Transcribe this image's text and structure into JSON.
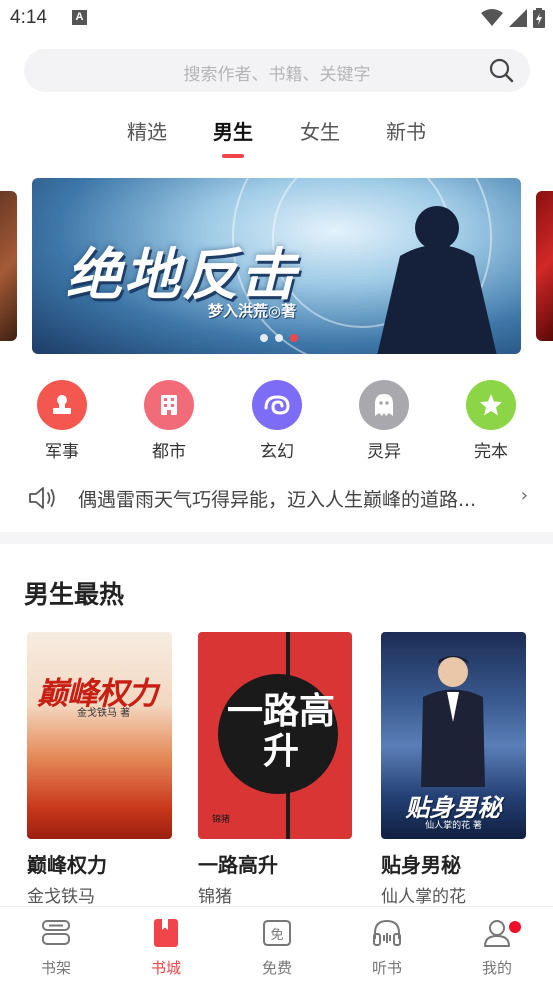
{
  "status_bar": {
    "time": "4:14",
    "notification_icon": "A"
  },
  "search": {
    "placeholder": "搜索作者、书籍、关键字"
  },
  "tabs": [
    {
      "label": "精选",
      "active": false
    },
    {
      "label": "男生",
      "active": true
    },
    {
      "label": "女生",
      "active": false
    },
    {
      "label": "新书",
      "active": false
    }
  ],
  "banner": {
    "title": "绝地反击",
    "author": "梦入洪荒◎著",
    "dots": 3,
    "active_dot": 3
  },
  "categories": [
    {
      "label": "军事",
      "icon": "stamp-icon",
      "color": "#f4574f"
    },
    {
      "label": "都市",
      "icon": "building-icon",
      "color": "#f26b78"
    },
    {
      "label": "玄幻",
      "icon": "swirl-icon",
      "color": "#7d6cf6"
    },
    {
      "label": "灵异",
      "icon": "ghost-icon",
      "color": "#a9a9ad"
    },
    {
      "label": "完本",
      "icon": "star-icon",
      "color": "#8bd546"
    }
  ],
  "notice": {
    "text": "偶遇雷雨天气巧得异能，迈入人生巅峰的道路..."
  },
  "section": {
    "title": "男生最热"
  },
  "books": [
    {
      "title": "巅峰权力",
      "author": "金戈铁马",
      "cover_text": "巅峰权力",
      "cover_author": "金戈铁马 著"
    },
    {
      "title": "一路高升",
      "author": "锦猪",
      "cover_text": "一路高升",
      "cover_author": "锦猪"
    },
    {
      "title": "贴身男秘",
      "author": "仙人掌的花",
      "cover_text": "贴身男秘",
      "cover_author": "仙人掌的花 著"
    }
  ],
  "bottom_nav": [
    {
      "label": "书架",
      "icon": "bookshelf-icon",
      "active": false
    },
    {
      "label": "书城",
      "icon": "bookstore-icon",
      "active": true
    },
    {
      "label": "免费",
      "icon": "free-icon",
      "active": false,
      "icon_text": "免"
    },
    {
      "label": "听书",
      "icon": "headphones-icon",
      "active": false
    },
    {
      "label": "我的",
      "icon": "profile-icon",
      "active": false,
      "badge": true
    }
  ],
  "colors": {
    "accent": "#f0464b",
    "badge": "#f0102a"
  }
}
